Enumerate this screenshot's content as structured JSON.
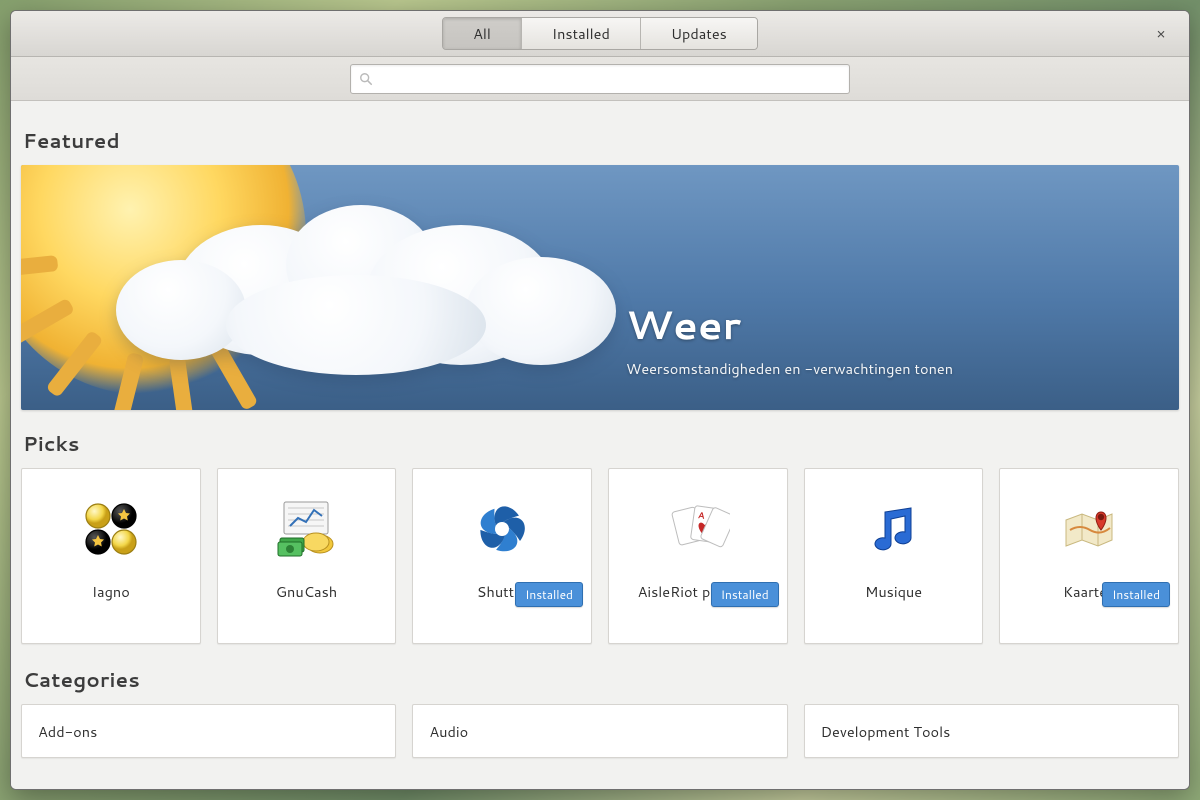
{
  "header": {
    "tabs": [
      {
        "label": "All",
        "active": true
      },
      {
        "label": "Installed",
        "active": false
      },
      {
        "label": "Updates",
        "active": false
      }
    ],
    "close_icon": "×"
  },
  "search": {
    "value": "",
    "placeholder": ""
  },
  "featured": {
    "section_title": "Featured",
    "app_title": "Weer",
    "app_subtitle": "Weersomstandigheden en -verwachtingen tonen"
  },
  "picks": {
    "section_title": "Picks",
    "installed_badge_label": "Installed",
    "items": [
      {
        "label": "Iagno",
        "installed": false,
        "icon": "iagno"
      },
      {
        "label": "GnuCash",
        "installed": false,
        "icon": "gnucash"
      },
      {
        "label": "Shutter",
        "installed": true,
        "icon": "shutter"
      },
      {
        "label": "AisleRiot patience",
        "installed": true,
        "icon": "aisleriot"
      },
      {
        "label": "Musique",
        "installed": false,
        "icon": "musique"
      },
      {
        "label": "Kaarten",
        "installed": true,
        "icon": "kaarten"
      }
    ]
  },
  "categories": {
    "section_title": "Categories",
    "items": [
      {
        "label": "Add-ons"
      },
      {
        "label": "Audio"
      },
      {
        "label": "Development Tools"
      }
    ]
  }
}
